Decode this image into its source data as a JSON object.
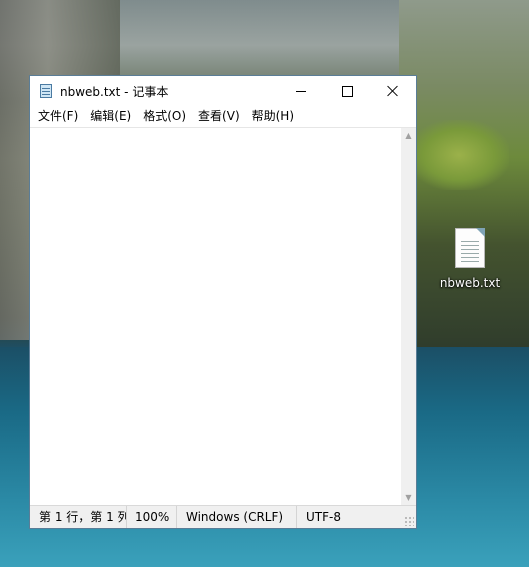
{
  "window": {
    "title": "nbweb.txt - 记事本",
    "controls": {
      "minimize_icon": "minimize-icon",
      "maximize_icon": "maximize-icon",
      "close_icon": "close-icon"
    }
  },
  "menu": {
    "items": [
      {
        "label": "文件(F)"
      },
      {
        "label": "编辑(E)"
      },
      {
        "label": "格式(O)"
      },
      {
        "label": "查看(V)"
      },
      {
        "label": "帮助(H)"
      }
    ]
  },
  "editor": {
    "content": ""
  },
  "status": {
    "position": "第 1 行，第 1 列",
    "zoom": "100%",
    "line_ending": "Windows (CRLF)",
    "encoding": "UTF-8"
  },
  "desktop": {
    "icons": [
      {
        "label": "nbweb.txt",
        "icon": "text-file-icon"
      }
    ]
  },
  "colors": {
    "window_border": "#5a7d97",
    "statusbar_bg": "#f0f0f0",
    "scrollbar_bg": "#f0f0f0"
  }
}
